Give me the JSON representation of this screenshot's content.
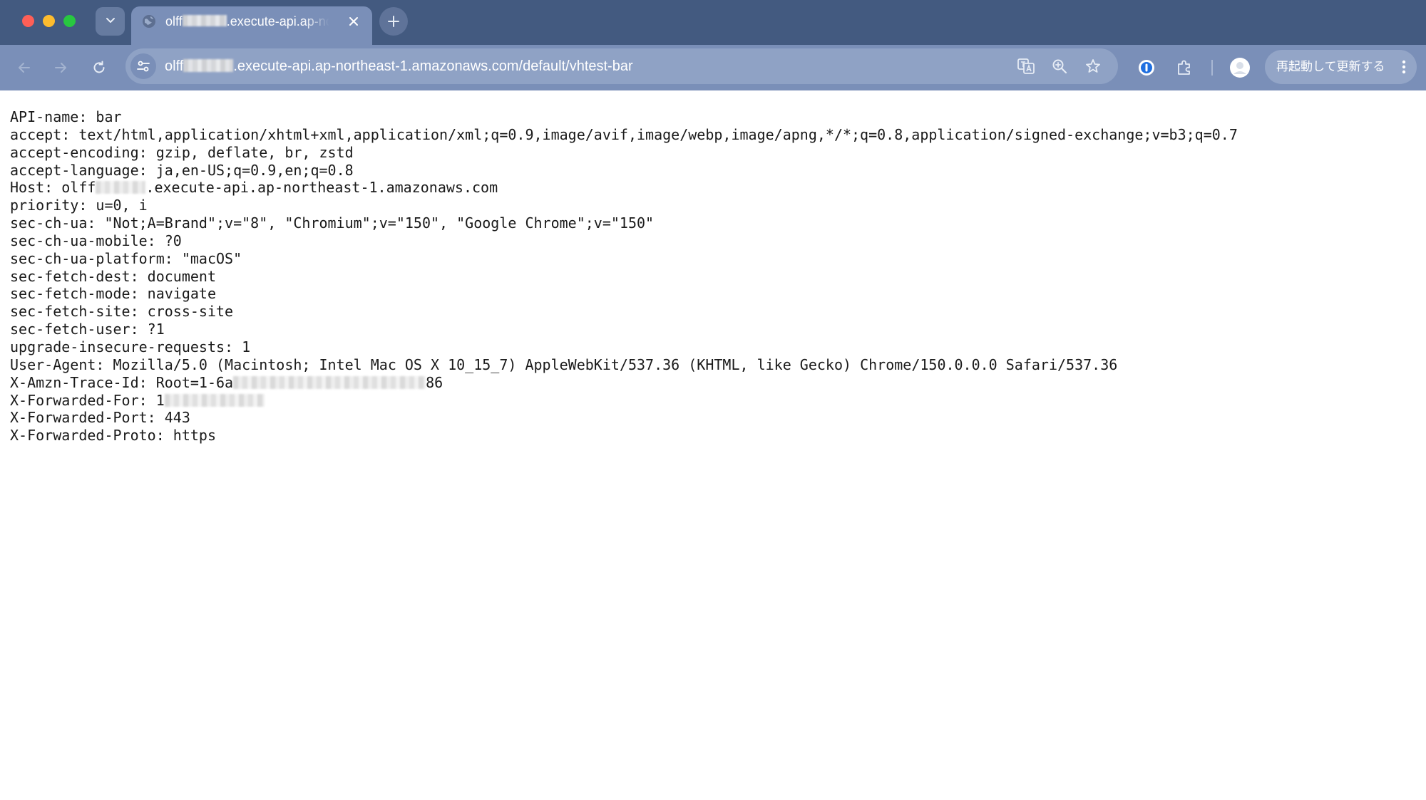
{
  "browser": {
    "tab": {
      "title": "olff",
      "title_suffix": ".execute-api.ap-northeast-1.amazonaws.com/default/vhtest-bar",
      "favicon": "globe-icon",
      "close_glyph": "✕"
    },
    "new_tab_glyph": "+",
    "address_bar": {
      "url_prefix": "olff",
      "url_suffix": ".execute-api.ap-northeast-1.amazonaws.com/default/vhtest-bar"
    },
    "relaunch_button": {
      "label": "再起動して更新する"
    },
    "colors": {
      "tab_strip": "#435a80",
      "toolbar": "#7a8fb8",
      "omnibox": "#8fa2c5"
    }
  },
  "page": {
    "lines": [
      {
        "key": "API-name: ",
        "value": "bar"
      },
      {
        "key": "accept: ",
        "value": "text/html,application/xhtml+xml,application/xml;q=0.9,image/avif,image/webp,image/apng,*/*;q=0.8,application/signed-exchange;v=b3;q=0.7"
      },
      {
        "key": "accept-encoding: ",
        "value": "gzip, deflate, br, zstd"
      },
      {
        "key": "accept-language: ",
        "value": "ja,en-US;q=0.9,en;q=0.8"
      },
      {
        "key": "Host: ",
        "value": "olff",
        "redacted": true,
        "value_after": ".execute-api.ap-northeast-1.amazonaws.com"
      },
      {
        "key": "priority: ",
        "value": "u=0, i"
      },
      {
        "key": "sec-ch-ua: ",
        "value": "\"Not;A=Brand\";v=\"8\", \"Chromium\";v=\"150\", \"Google Chrome\";v=\"150\""
      },
      {
        "key": "sec-ch-ua-mobile: ",
        "value": "?0"
      },
      {
        "key": "sec-ch-ua-platform: ",
        "value": "\"macOS\""
      },
      {
        "key": "sec-fetch-dest: ",
        "value": "document"
      },
      {
        "key": "sec-fetch-mode: ",
        "value": "navigate"
      },
      {
        "key": "sec-fetch-site: ",
        "value": "cross-site"
      },
      {
        "key": "sec-fetch-user: ",
        "value": "?1"
      },
      {
        "key": "upgrade-insecure-requests: ",
        "value": "1"
      },
      {
        "key": "User-Agent: ",
        "value": "Mozilla/5.0 (Macintosh; Intel Mac OS X 10_15_7) AppleWebKit/537.36 (KHTML, like Gecko) Chrome/150.0.0.0 Safari/537.36"
      },
      {
        "key": "X-Amzn-Trace-Id: ",
        "value": "Root=1-6a",
        "redacted": true,
        "value_after": "86"
      },
      {
        "key": "X-Forwarded-For: ",
        "value": "1",
        "redacted": true,
        "value_after": ""
      },
      {
        "key": "X-Forwarded-Port: ",
        "value": "443"
      },
      {
        "key": "X-Forwarded-Proto: ",
        "value": "https"
      }
    ]
  }
}
